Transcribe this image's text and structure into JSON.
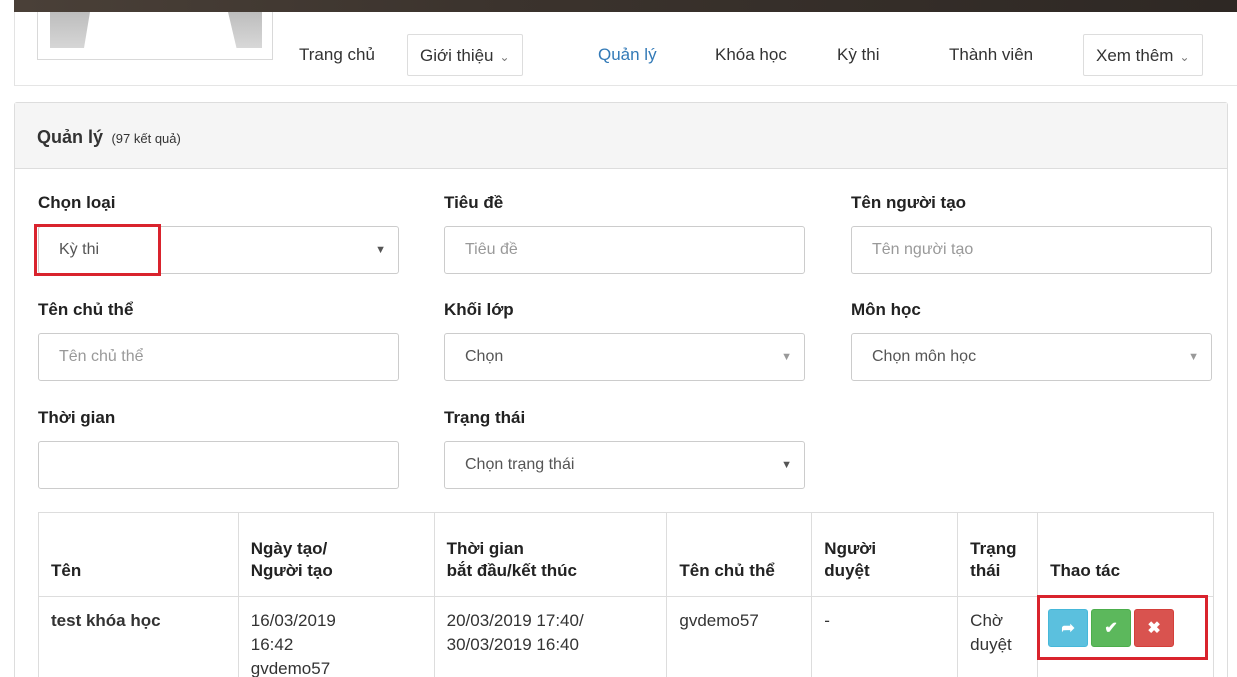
{
  "nav": {
    "home": "Trang chủ",
    "about": "Giới thiệu",
    "manage": "Quản lý",
    "courses": "Khóa học",
    "exams": "Kỳ thi",
    "members": "Thành viên",
    "more": "Xem thêm"
  },
  "panel": {
    "title": "Quản lý",
    "count": "(97 kết quả)"
  },
  "filters": {
    "type": {
      "label": "Chọn loại",
      "value": "Kỳ thi"
    },
    "title": {
      "label": "Tiêu đề",
      "placeholder": "Tiêu đề"
    },
    "creator": {
      "label": "Tên người tạo",
      "placeholder": "Tên người tạo"
    },
    "subject_owner": {
      "label": "Tên chủ thể",
      "placeholder": "Tên chủ thể"
    },
    "grade": {
      "label": "Khối lớp",
      "value": "Chọn"
    },
    "course": {
      "label": "Môn học",
      "value": "Chọn môn học"
    },
    "time": {
      "label": "Thời gian",
      "value": ""
    },
    "status": {
      "label": "Trạng thái",
      "value": "Chọn trạng thái"
    }
  },
  "table": {
    "headers": {
      "name": "Tên",
      "created_1": "Ngày tạo/",
      "created_2": "Người tạo",
      "time_1": "Thời gian",
      "time_2": "bắt đầu/kết thúc",
      "owner": "Tên chủ thể",
      "reviewer_1": "Người",
      "reviewer_2": "duyệt",
      "status_1": "Trạng",
      "status_2": "thái",
      "actions": "Thao tác"
    },
    "rows": [
      {
        "name": "test khóa học",
        "created_date": "16/03/2019",
        "created_time": "16:42",
        "created_by": "gvdemo57",
        "start": "20/03/2019 17:40/",
        "end": "30/03/2019 16:40",
        "owner": "gvdemo57",
        "reviewer": "-",
        "status_1": "Chờ",
        "status_2": "duyệt"
      }
    ]
  },
  "icons": {
    "share": "share-icon",
    "approve": "check-icon",
    "delete": "close-icon"
  },
  "colors": {
    "accent": "#337ab7",
    "highlight": "#d9232d",
    "info": "#5bc0de",
    "success": "#5cb85c",
    "danger": "#d9534f"
  }
}
